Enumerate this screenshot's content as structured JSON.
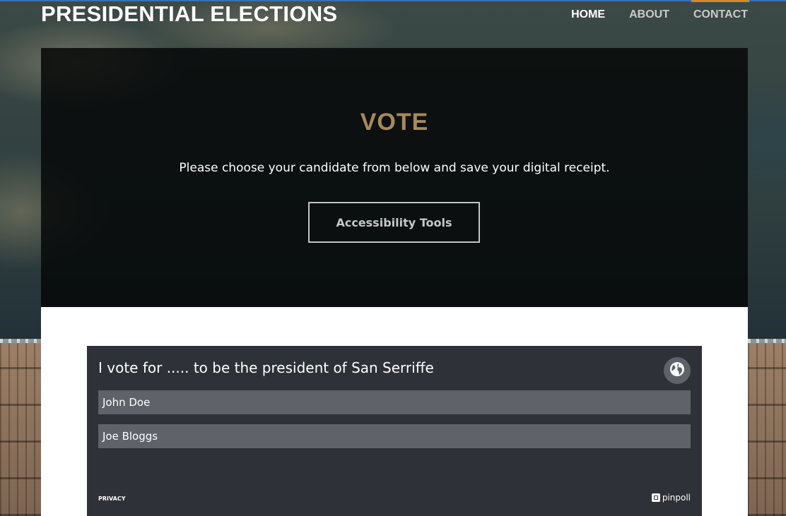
{
  "header": {
    "site_title": "PRESIDENTIAL ELECTIONS",
    "nav": [
      {
        "label": "HOME",
        "active": true
      },
      {
        "label": "ABOUT",
        "active": false
      },
      {
        "label": "CONTACT",
        "active": false
      }
    ]
  },
  "hero": {
    "title": "VOTE",
    "description": "Please choose your candidate from below and save your digital receipt.",
    "button_label": "Accessibility Tools"
  },
  "poll": {
    "question": "I vote for ..... to be the president of San Serriffe",
    "options": [
      {
        "label": "John Doe"
      },
      {
        "label": "Joe Bloggs"
      }
    ],
    "privacy_label": "PRIVACY",
    "brand_name": "pinpoll",
    "language_icon": "globe-icon"
  },
  "colors": {
    "accent_gold": "#a8895a",
    "poll_background": "#2e3138",
    "option_background": "#5f6369",
    "hero_overlay": "#060808"
  }
}
